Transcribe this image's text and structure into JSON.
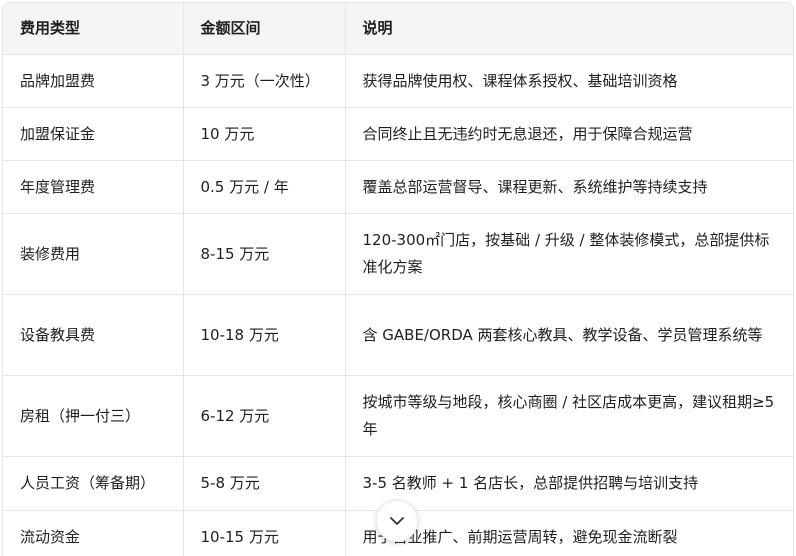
{
  "table": {
    "headers": [
      "费用类型",
      "金额区间",
      "说明"
    ],
    "rows": [
      {
        "type": "品牌加盟费",
        "amount": "3 万元（一次性）",
        "desc": "获得品牌使用权、课程体系授权、基础培训资格"
      },
      {
        "type": "加盟保证金",
        "amount": "10 万元",
        "desc": "合同终止且无违约时无息退还，用于保障合规运营"
      },
      {
        "type": "年度管理费",
        "amount": "0.5 万元 / 年",
        "desc": "覆盖总部运营督导、课程更新、系统维护等持续支持"
      },
      {
        "type": "装修费用",
        "amount": "8-15 万元",
        "desc": "120-300㎡门店，按基础 / 升级 / 整体装修模式，总部提供标准化方案"
      },
      {
        "type": "设备教具费",
        "amount": "10-18 万元",
        "desc": "含 GABE/ORDA 两套核心教具、教学设备、学员管理系统等"
      },
      {
        "type": "房租（押一付三）",
        "amount": "6-12 万元",
        "desc": "按城市等级与地段，核心商圈 / 社区店成本更高，建议租期≥5 年"
      },
      {
        "type": "人员工资（筹备期）",
        "amount": "5-8 万元",
        "desc": "3-5 名教师 + 1 名店长，总部提供招聘与培训支持"
      },
      {
        "type": "流动资金",
        "amount": "10-15 万元",
        "desc": "用于营业推广、前期运营周转，避免现金流断裂"
      }
    ]
  },
  "scroll_button": {
    "icon": "chevron-down-icon"
  }
}
